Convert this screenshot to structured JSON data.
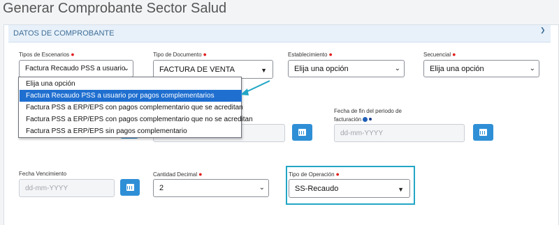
{
  "page": {
    "title": "Generar Comprobante Sector Salud"
  },
  "panel": {
    "title": "DATOS DE COMPROBANTE",
    "collapse_icon": "chevron-up-icon"
  },
  "fields": {
    "tipos_escenarios": {
      "label": "Tipos de Escenarios",
      "value": "Factura Recaudo PSS a usuario"
    },
    "tipo_documento": {
      "label": "Tipo de Documento",
      "value": "FACTURA DE VENTA"
    },
    "establecimiento": {
      "label": "Establecimiento",
      "value": "Elija una opción"
    },
    "secuencial": {
      "label": "Secuencial",
      "value": "Elija una opción"
    },
    "fecha_fin": {
      "label_line1": "Fecha de fin del periodo de",
      "label_line2": "facturación",
      "placeholder": "dd-mm-YYYY"
    },
    "fecha_vencimiento": {
      "label": "Fecha Vencimiento",
      "placeholder": "dd-mm-YYYY"
    },
    "cantidad_decimal": {
      "label": "Cantidad Decimal",
      "value": "2"
    },
    "tipo_operacion": {
      "label": "Tipo de Operación",
      "value": "SS-Recaudo"
    }
  },
  "dropdown": {
    "options": [
      "Elija una opción",
      "Factura Recaudo PSS a usuario por pagos complementarios",
      "Factura PSS a ERP/EPS con pagos complementario que se acreditan",
      "Factura PSS a ERP/EPS con pagos complementario que no se acreditan",
      "Factura PSS a ERP/EPS sin pagos complementario"
    ],
    "selected_index": 1
  },
  "colors": {
    "accent": "#2f8fd6",
    "highlight": "#22a6c5",
    "selection": "#1f6fd0",
    "required": "#e02020"
  }
}
